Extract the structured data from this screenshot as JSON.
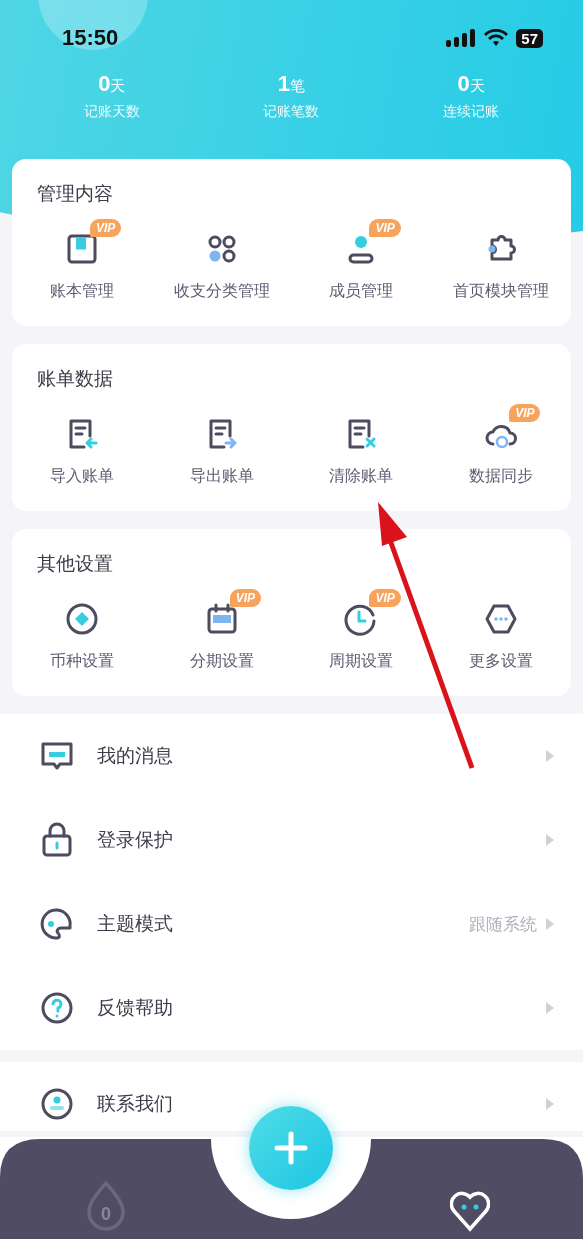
{
  "status_bar": {
    "time": "15:50",
    "battery": "57"
  },
  "stats": [
    {
      "value": "0",
      "unit": "天",
      "label": "记账天数"
    },
    {
      "value": "1",
      "unit": "笔",
      "label": "记账笔数"
    },
    {
      "value": "0",
      "unit": "天",
      "label": "连续记账"
    }
  ],
  "sections": [
    {
      "title": "管理内容",
      "items": [
        {
          "kind": "book",
          "label": "账本管理",
          "badge": "VIP"
        },
        {
          "kind": "category",
          "label": "收支分类管理"
        },
        {
          "kind": "member",
          "label": "成员管理",
          "badge": "VIP"
        },
        {
          "kind": "puzzle",
          "label": "首页模块管理"
        }
      ]
    },
    {
      "title": "账单数据",
      "items": [
        {
          "kind": "import",
          "label": "导入账单"
        },
        {
          "kind": "export",
          "label": "导出账单"
        },
        {
          "kind": "clear",
          "label": "清除账单"
        },
        {
          "kind": "cloud",
          "label": "数据同步",
          "badge": "VIP"
        }
      ]
    },
    {
      "title": "其他设置",
      "items": [
        {
          "kind": "currency",
          "label": "币种设置"
        },
        {
          "kind": "calendar",
          "label": "分期设置",
          "badge": "VIP"
        },
        {
          "kind": "clock",
          "label": "周期设置",
          "badge": "VIP"
        },
        {
          "kind": "more",
          "label": "更多设置"
        }
      ]
    }
  ],
  "menu": [
    {
      "kind": "message",
      "label": "我的消息"
    },
    {
      "kind": "lock",
      "label": "登录保护"
    },
    {
      "kind": "palette",
      "label": "主题模式",
      "value": "跟随系统"
    },
    {
      "kind": "help",
      "label": "反馈帮助"
    }
  ],
  "menu_2": [
    {
      "kind": "contact",
      "label": "联系我们"
    }
  ],
  "nav": {
    "tabs": [
      {
        "kind": "drop",
        "label": "0",
        "selected": false
      },
      {
        "kind": "heart",
        "selected": true
      }
    ]
  }
}
